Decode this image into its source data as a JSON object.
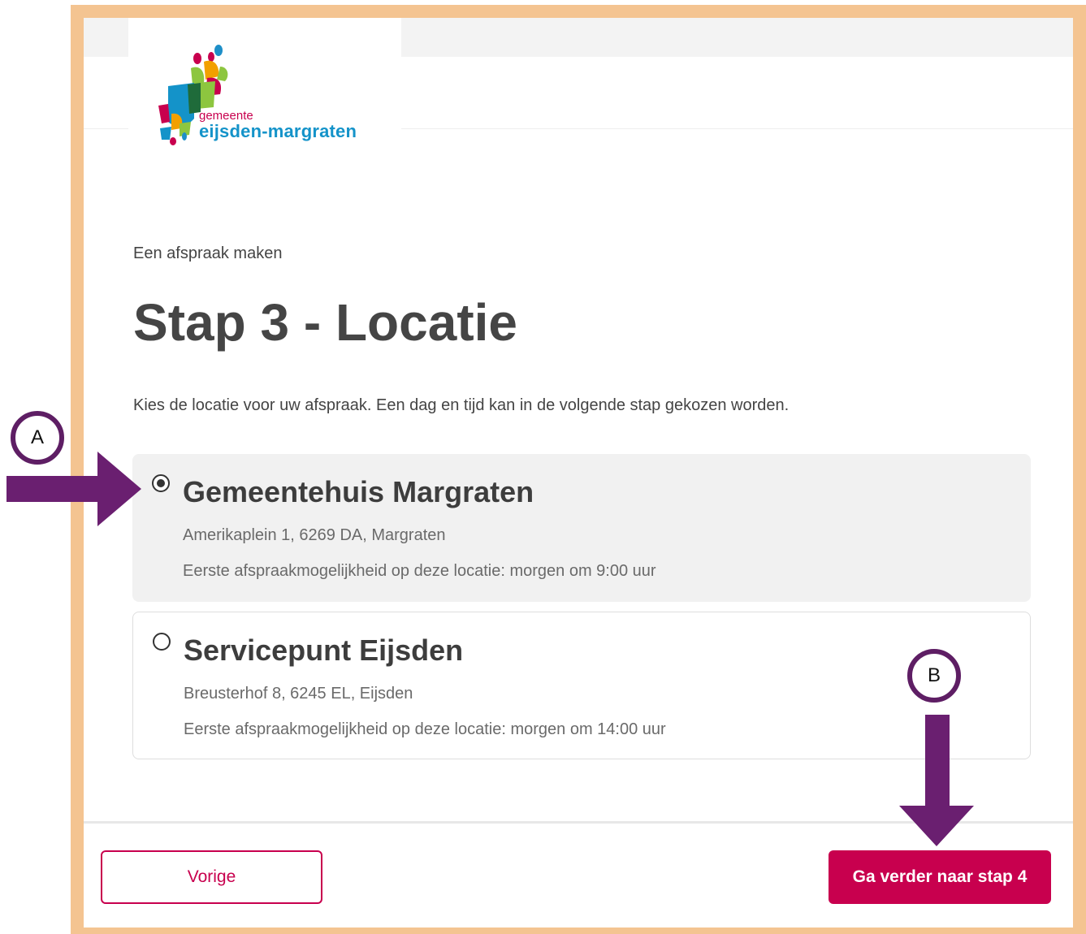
{
  "logo": {
    "small_text": "gemeente",
    "big_text": "eijsden-margraten",
    "icon": "municipality-logo-mosaic"
  },
  "breadcrumb": "Een afspraak maken",
  "page_title": "Stap 3 - Locatie",
  "intro": "Kies de locatie voor uw afspraak. Een dag en tijd kan in de volgende stap gekozen worden.",
  "locations": [
    {
      "name": "Gemeentehuis Margraten",
      "address": "Amerikaplein 1, 6269 DA, Margraten",
      "first_slot": "Eerste afspraakmogelijkheid op deze locatie: morgen om 9:00 uur",
      "selected": true
    },
    {
      "name": "Servicepunt Eijsden",
      "address": "Breusterhof 8, 6245 EL, Eijsden",
      "first_slot": "Eerste afspraakmogelijkheid op deze locatie: morgen om 14:00 uur",
      "selected": false
    }
  ],
  "buttons": {
    "previous": "Vorige",
    "next": "Ga verder naar stap 4"
  },
  "annotations": {
    "a": "A",
    "b": "B"
  },
  "colors": {
    "brand": "#c8004e",
    "frame": "#f4c491",
    "annotation": "#5e1e64",
    "logo_blue": "#1493c9"
  }
}
